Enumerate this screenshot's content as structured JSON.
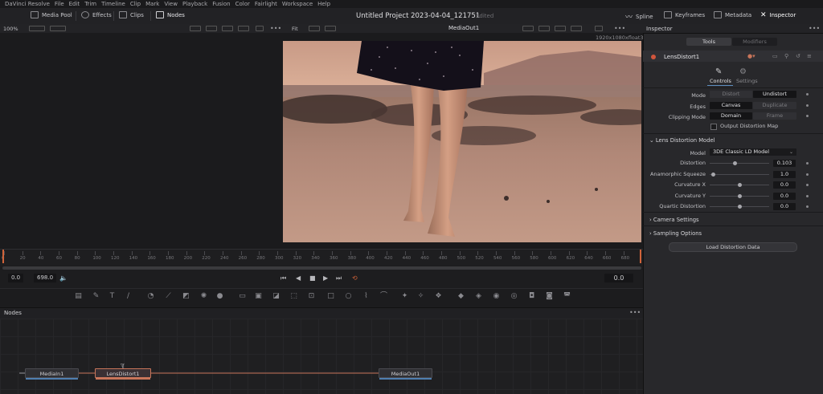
{
  "menu": [
    "DaVinci Resolve",
    "File",
    "Edit",
    "Trim",
    "Timeline",
    "Clip",
    "Mark",
    "View",
    "Playback",
    "Fusion",
    "Color",
    "Fairlight",
    "Workspace",
    "Help"
  ],
  "toolbar": {
    "media_pool": "Media Pool",
    "effects": "Effects",
    "clips": "Clips",
    "nodes": "Nodes",
    "project_title": "Untitled Project 2023-04-04_121751",
    "edited": "Edited",
    "spline": "Spline",
    "keyframes": "Keyframes",
    "metadata": "Metadata",
    "inspector": "Inspector"
  },
  "viewer": {
    "zoom": "100%",
    "fit": "Fit",
    "name": "MediaOut1",
    "resolution": "1920x1080xfloat32",
    "ruler_ticks": [
      "0",
      "20",
      "40",
      "60",
      "80",
      "100",
      "120",
      "140",
      "160",
      "180",
      "200",
      "220",
      "240",
      "260",
      "280",
      "300",
      "320",
      "340",
      "360",
      "380",
      "400",
      "420",
      "440",
      "460",
      "480",
      "500",
      "520",
      "540",
      "560",
      "580",
      "600",
      "620",
      "640",
      "660",
      "680"
    ],
    "time_start": "0.0",
    "time_end": "698.0",
    "current_time": "0.0"
  },
  "nodes_panel": {
    "title": "Nodes",
    "items": [
      {
        "label": "MediaIn1"
      },
      {
        "label": "LensDistort1"
      },
      {
        "label": "MediaOut1"
      }
    ]
  },
  "inspector": {
    "title": "Inspector",
    "tabs": [
      "Tools",
      "Modifiers"
    ],
    "node_name": "LensDistort1",
    "subtabs": [
      "Controls",
      "Settings"
    ],
    "mode": {
      "label": "Mode",
      "options": [
        "Distort",
        "Undistort"
      ],
      "selected": "Undistort"
    },
    "edges": {
      "label": "Edges",
      "options": [
        "Canvas",
        "Duplicate"
      ],
      "selected": "Canvas"
    },
    "clipping": {
      "label": "Clipping Mode",
      "options": [
        "Domain",
        "Frame"
      ],
      "selected": "Domain"
    },
    "output_map": "Output Distortion Map",
    "model_section": "Lens Distortion Model",
    "model": {
      "label": "Model",
      "value": "3DE Classic LD Model"
    },
    "params": [
      {
        "label": "Distortion",
        "value": "0.103",
        "pos": 0.42
      },
      {
        "label": "Anamorphic Squeeze",
        "value": "1.0",
        "pos": 0.05
      },
      {
        "label": "Curvature X",
        "value": "0.0",
        "pos": 0.5
      },
      {
        "label": "Curvature Y",
        "value": "0.0",
        "pos": 0.5
      },
      {
        "label": "Quartic Distortion",
        "value": "0.0",
        "pos": 0.5
      }
    ],
    "camera_settings": "Camera Settings",
    "sampling_options": "Sampling Options",
    "load_button": "Load Distortion Data"
  },
  "colors": {
    "accent": "#4f7fb0",
    "selected_node": "#c8755a",
    "playhead": "#d2643a"
  }
}
